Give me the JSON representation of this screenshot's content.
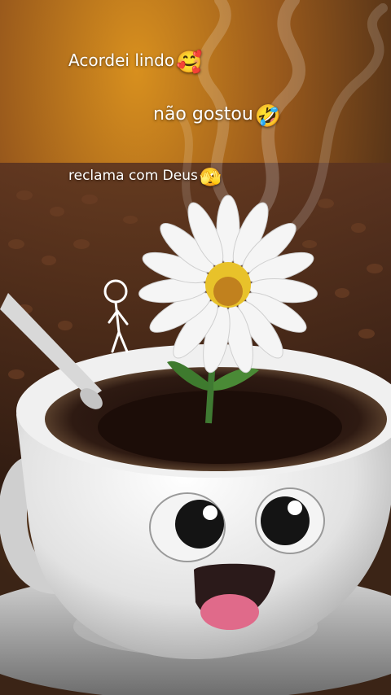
{
  "captions": {
    "line1": {
      "text": "Acordei lindo",
      "emoji": "🥰"
    },
    "line2": {
      "text": "não gostou",
      "emoji": "🤣"
    },
    "line3": {
      "text": "reclama com Deus",
      "emoji": "🫣"
    }
  },
  "colors": {
    "bg_top": "#c47a1a",
    "bg_mid": "#7a4a22",
    "beans": "#4a2a1a",
    "cup": "#e8e8e8",
    "coffee": "#2a1510",
    "petal": "#f4f4f4",
    "flower_center": "#e8c22a",
    "mouth": "#2b1a1a",
    "tongue": "#e06a8a"
  }
}
